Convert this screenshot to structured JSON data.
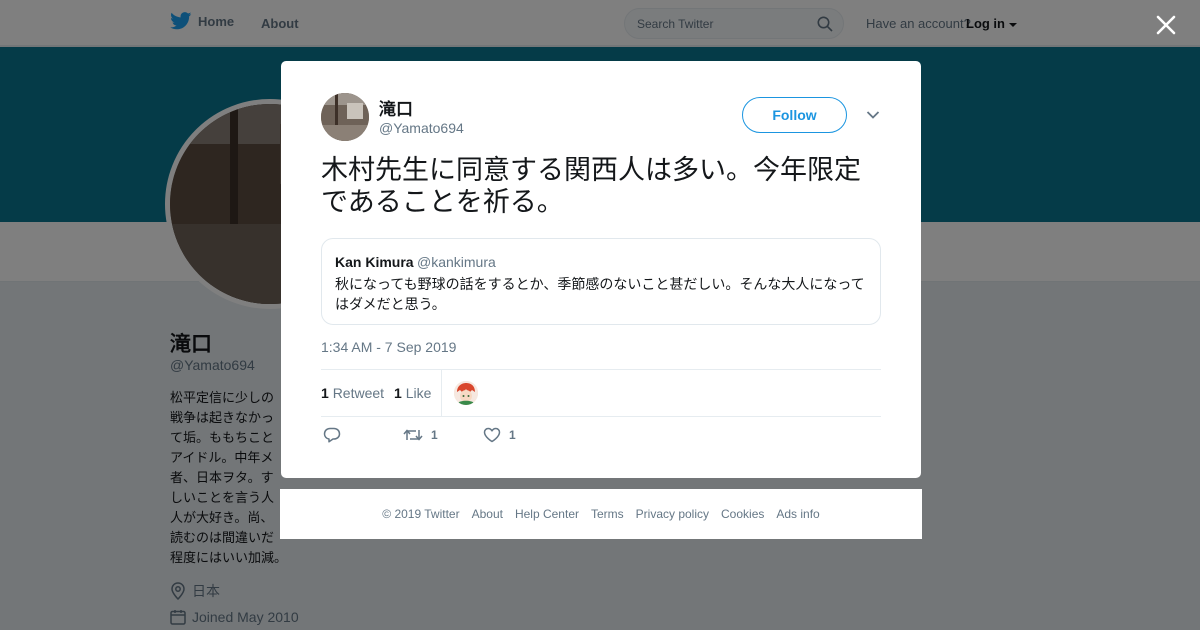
{
  "topbar": {
    "home_label": "Home",
    "about_label": "About",
    "search_placeholder": "Search Twitter",
    "have_account": "Have an account?",
    "login_label": "Log in"
  },
  "profile": {
    "name": "滝口",
    "handle": "@Yamato694",
    "bio": "松平定信に少しの\n戦争は起きなかっ\nて垢。ももちこと\nアイドル。中年メ\n者、日本ヲタ。す\nしいことを言う人\n人が大好き。尚、\n読むのは間違いだ\n程度にはいい加減。",
    "location": "日本",
    "joined": "Joined May 2010",
    "banner_color": "#0b7790"
  },
  "tweet": {
    "author_name": "滝口",
    "author_handle": "@Yamato694",
    "follow_label": "Follow",
    "text": "木村先生に同意する関西人は多い。今年限定であることを祈る。",
    "quote": {
      "name": "Kan Kimura",
      "handle": "@kankimura",
      "text": "秋になっても野球の話をするとか、季節感のないこと甚だしい。そんな大人になってはダメだと思う。"
    },
    "timestamp": "1:34 AM - 7 Sep 2019",
    "retweet_count": "1",
    "retweet_label": "Retweet",
    "like_count": "1",
    "like_label": "Like",
    "actions": {
      "retweet_count": "1",
      "like_count": "1"
    }
  },
  "footer": {
    "copyright": "© 2019 Twitter",
    "links": [
      "About",
      "Help Center",
      "Terms",
      "Privacy policy",
      "Cookies",
      "Ads info"
    ]
  },
  "icons": [
    "twitter-bird-icon",
    "search-icon",
    "caret-down-icon",
    "close-icon",
    "location-icon",
    "calendar-icon",
    "reply-icon",
    "retweet-icon",
    "heart-icon",
    "chevron-down-icon"
  ],
  "colors": {
    "accent": "#1b95e0",
    "banner": "#0b7790",
    "muted": "#657786"
  }
}
